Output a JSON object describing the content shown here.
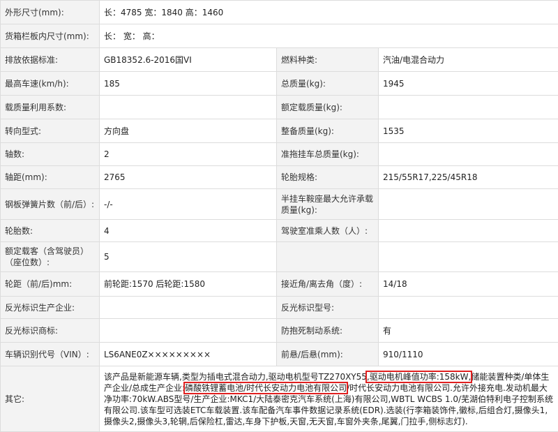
{
  "rows": [
    {
      "k": "外形尺寸(mm):",
      "v": "长：4785 宽：1840 高：1460"
    },
    {
      "k": "货箱栏板内尺寸(mm):",
      "v": "长： 宽： 高："
    },
    {
      "k1": "排放依据标准:",
      "v1": "GB18352.6-2016国VI",
      "k2": "燃料种类:",
      "v2": "汽油/电混合动力"
    },
    {
      "k1": "最高车速(km/h):",
      "v1": "185",
      "k2": "总质量(kg):",
      "v2": "1945"
    },
    {
      "k1": "载质量利用系数:",
      "v1": "",
      "k2": "额定载质量(kg):",
      "v2": ""
    },
    {
      "k1": "转向型式:",
      "v1": "方向盘",
      "k2": "整备质量(kg):",
      "v2": "1535"
    },
    {
      "k1": "轴数:",
      "v1": "2",
      "k2": "准拖挂车总质量(kg):",
      "v2": ""
    },
    {
      "k1": "轴距(mm):",
      "v1": "2765",
      "k2": "轮胎规格:",
      "v2": "215/55R17,225/45R18"
    },
    {
      "k1": "钢板弹簧片数（前/后）:",
      "v1": "-/-",
      "k2": "半挂车鞍座最大允许承载质量(kg):",
      "v2": ""
    },
    {
      "k1": "轮胎数:",
      "v1": "4",
      "k2": "驾驶室准乘人数（人）:",
      "v2": ""
    },
    {
      "k1": "额定载客（含驾驶员）（座位数）:",
      "v1": "5",
      "k2": "",
      "v2": ""
    },
    {
      "k1": "轮距（前/后)mm:",
      "v1": "前轮距:1570 后轮距:1580",
      "k2": "接近角/离去角（度）:",
      "v2": "14/18"
    },
    {
      "k1": "反光标识生产企业:",
      "v1": "",
      "k2": "反光标识型号:",
      "v2": ""
    },
    {
      "k1": "反光标识商标:",
      "v1": "",
      "k2": "防抱死制动系统:",
      "v2": "有"
    },
    {
      "k1": "车辆识别代号（VIN）:",
      "v1": "LS6ANE0Z×××××××××",
      "k2": "前悬/后悬(mm):",
      "v2": "910/1110"
    }
  ],
  "other": {
    "label": "其它:",
    "t1": "该产品是新能源车辆,类型为插电式混合动力,驱动电机型号TZ270XY55",
    "h1": ",驱动电机峰值功率:158kW,",
    "t2": "储能装置种类/单体生产企业/总成生产企业:",
    "h2": "磷酸铁锂蓄电池/时代长安动力电池有限公司",
    "t3": "/时代长安动力电池有限公司.允许外接充电.发动机最大净功率:70kW.ABS型号/生产企业:MKC1/大陆泰密克汽车系统(上海)有限公司,WBTL WCBS 1.0/芜湖伯特利电子控制系统有限公司.该车型可选装ETC车载装置.该车配备汽车事件数据记录系统(EDR).选装(行李箱装饰件,徽标,后组合灯,摄像头1,摄像头2,摄像头3,轮辋,后保险杠,雷达,车身下护板,天窗,无天窗,车窗外夹条,尾翼,门拉手,侧标志灯)."
  },
  "colors": {
    "label_bg": "#f3f3f3",
    "border": "#dcdcdc",
    "highlight": "#e02020"
  }
}
